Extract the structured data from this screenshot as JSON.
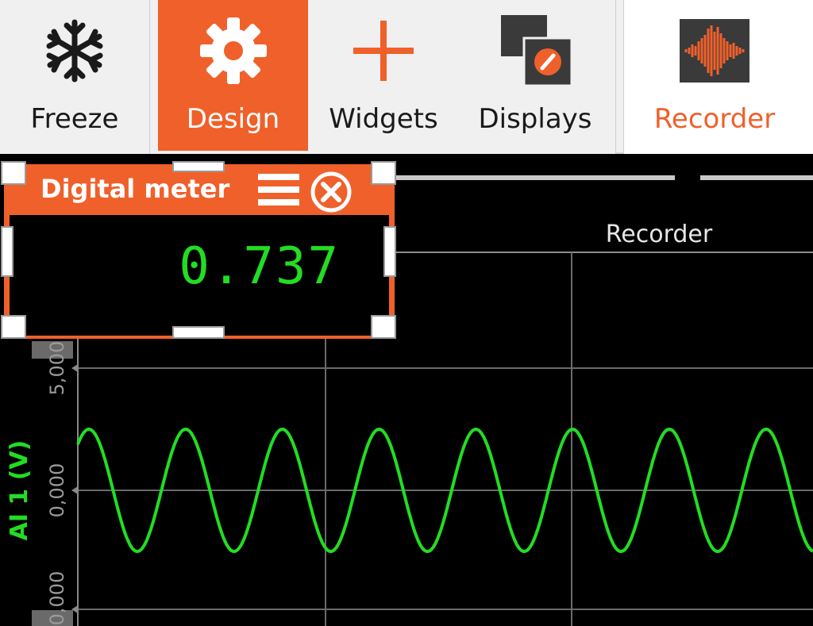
{
  "toolbar": {
    "buttons": [
      {
        "id": "freeze",
        "label": "Freeze",
        "icon": "snowflake-icon"
      },
      {
        "id": "design",
        "label": "Design",
        "icon": "gear-icon",
        "active": true
      },
      {
        "id": "widgets",
        "label": "Widgets",
        "icon": "plus-icon"
      },
      {
        "id": "displays",
        "label": "Displays",
        "icon": "displays-icon"
      },
      {
        "id": "recorder",
        "label": "Recorder",
        "icon": "waveform-icon"
      }
    ],
    "accent_color": "#f0602a"
  },
  "digital_meter": {
    "title": "Digital meter",
    "value": "0.737",
    "value_color": "#22dd22"
  },
  "recorder_chart": {
    "title": "Recorder",
    "y_axis_label": "AI 1 (V)",
    "y_ticks": [
      "5,000",
      "0,000",
      "0,000"
    ],
    "series_color": "#22dd22"
  },
  "chart_data": {
    "type": "line",
    "title": "Recorder",
    "ylabel": "AI 1 (V)",
    "ylim": [
      -5,
      5
    ],
    "series": [
      {
        "name": "AI 1 (V)",
        "waveform": "sine",
        "amplitude": 2.5,
        "offset": 0.0,
        "cycles_visible": 7.6
      }
    ],
    "grid": true
  }
}
